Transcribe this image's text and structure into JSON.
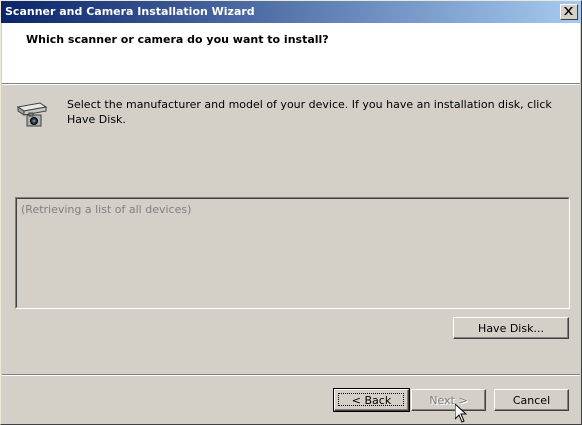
{
  "window": {
    "title": "Scanner and Camera Installation Wizard",
    "close_label": "×"
  },
  "header": {
    "title": "Which scanner or camera do you want to install?"
  },
  "main": {
    "device_icon": "scanner-camera-icon",
    "instructions": "Select the manufacturer and model of your device. If you have an installation disk, click Have Disk.",
    "device_list_status": "(Retrieving a list of all devices)"
  },
  "buttons": {
    "have_disk": "Have Disk...",
    "back": "< Back",
    "next": "Next >",
    "cancel": "Cancel"
  },
  "colors": {
    "titlebar_start": "#0a246a",
    "titlebar_end": "#a6caf0",
    "dialog_bg": "#d4d0c8",
    "header_bg": "#ffffff",
    "disabled_text": "#808080"
  }
}
